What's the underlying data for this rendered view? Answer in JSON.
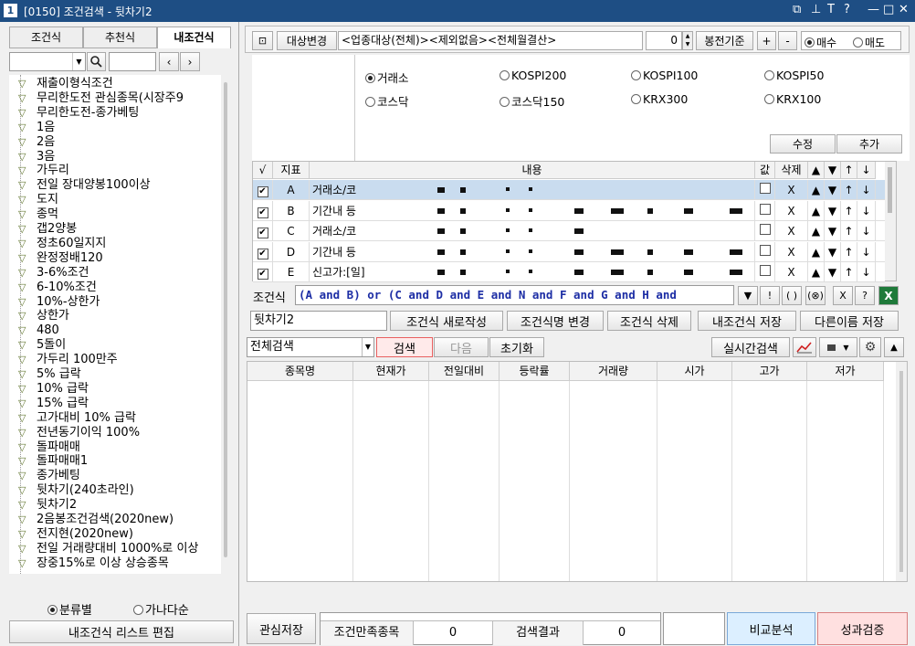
{
  "window": {
    "number": "1",
    "title": "[0150] 조건검색 - 뒷차기2",
    "controls": [
      "⧉",
      "⊥",
      "T",
      "?",
      "—",
      "□",
      "✕"
    ]
  },
  "left": {
    "tabs": [
      "조건식",
      "추천식",
      "내조건식"
    ],
    "active_tab": "내조건식",
    "tree_items": [
      "재출이형식조건",
      "무리한도전 관심종목(시장주9",
      "무리한도전-종가베팅",
      "1음",
      "2음",
      "3음",
      "가두리",
      "전일 장대양봉100이상",
      "도지",
      "종먹",
      "갭2양봉",
      "정초60일지지",
      "완정정배120",
      "3-6%조건",
      "6-10%조건",
      "10%-상한가",
      "상한가",
      "480",
      "5돌이",
      "가두리 100만주",
      "5% 급락",
      "10% 급락",
      "15% 급락",
      "고가대비 10% 급락",
      "전년동기이익 100%",
      "돌파매매",
      "돌파매매1",
      "종가베팅",
      "뒷차기(240초라인)",
      "뒷차기2",
      "2음봉조건검색(2020new)",
      "전지현(2020new)",
      "전일 거래량대비 1000%로 이상",
      "장중15%로 이상 상승종목"
    ],
    "sort_options": [
      "분류별",
      "가나다순"
    ],
    "sort_selected": "분류별",
    "edit_list_btn": "내조건식 리스트 편집"
  },
  "top": {
    "target_btn": "대상변경",
    "target_text": "<업종대상(전체)><제외없음><전체월결산>",
    "spin_value": "0",
    "base_btn": "봉전기준",
    "plus": "+",
    "minus": "-",
    "trade_options": [
      "매수",
      "매도"
    ],
    "trade_selected": "매수"
  },
  "markets": {
    "row1": [
      "거래소",
      "KOSPI200",
      "KOSPI100",
      "KOSPI50"
    ],
    "row2": [
      "코스닥",
      "코스닥150",
      "KRX300",
      "KRX100"
    ],
    "selected": "거래소"
  },
  "edit_buttons": {
    "modify": "수정",
    "add": "추가"
  },
  "cond_table": {
    "headers": [
      "√",
      "지표",
      "내용",
      "값",
      "삭제",
      "▲",
      "▼",
      "↑",
      "↓"
    ],
    "rows": [
      {
        "id": "A",
        "text": "거래소/코"
      },
      {
        "id": "B",
        "text": "기간내 등"
      },
      {
        "id": "C",
        "text": "거래소/코"
      },
      {
        "id": "D",
        "text": "기간내 등"
      },
      {
        "id": "E",
        "text": "신고가:[일]"
      }
    ],
    "del": "X"
  },
  "formula": {
    "label": "조건식",
    "expr": "(A and B) or (C and D and E and N and F and G and H and"
  },
  "formula_tools": [
    "▼",
    "!",
    "( )",
    "(⊗)",
    "X",
    "?"
  ],
  "name_row": {
    "name": "뒷차기2",
    "buttons": [
      "조건식 새로작성",
      "조건식명 변경",
      "조건식 삭제",
      "내조건식 저장",
      "다른이름 저장"
    ]
  },
  "search_row": {
    "select": "전체검색",
    "search": "검색",
    "next": "다음",
    "reset": "초기화",
    "realtime": "실시간검색"
  },
  "result_headers": [
    "종목명",
    "현재가",
    "전일대비",
    "등락률",
    "거래량",
    "시가",
    "고가",
    "저가"
  ],
  "bottom": {
    "save_fav": "관심저장",
    "match_label": "조건만족종목",
    "match_value": "0",
    "result_label": "검색결과",
    "result_value": "0",
    "compare": "비교분석",
    "verify": "성과검증"
  }
}
